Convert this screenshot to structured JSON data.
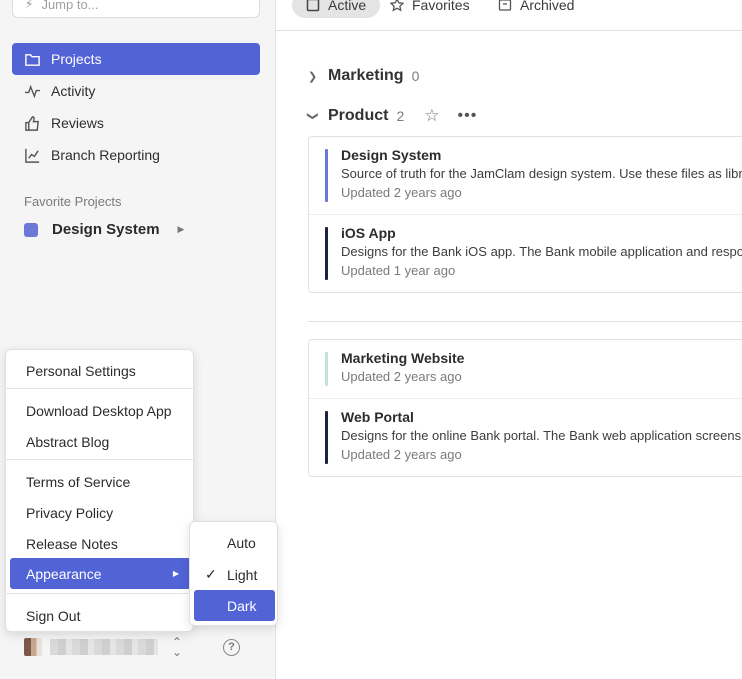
{
  "sidebar": {
    "jump_placeholder": "Jump to...",
    "nav": [
      {
        "label": "Projects",
        "icon": "folder-icon",
        "active": true
      },
      {
        "label": "Activity",
        "icon": "activity-icon"
      },
      {
        "label": "Reviews",
        "icon": "thumbs-up-icon"
      },
      {
        "label": "Branch Reporting",
        "icon": "chart-icon"
      }
    ],
    "favorites_title": "Favorite Projects",
    "favorites": [
      {
        "label": "Design System",
        "color": "#6b78d8"
      }
    ],
    "help_glyph": "?"
  },
  "tabs": [
    {
      "label": "Active",
      "active": true
    },
    {
      "label": "Favorites"
    },
    {
      "label": "Archived"
    }
  ],
  "sections": [
    {
      "title": "Marketing",
      "count": "0",
      "expanded": false
    },
    {
      "title": "Product",
      "count": "2",
      "expanded": true
    }
  ],
  "product_projects": [
    {
      "name": "Design System",
      "desc": "Source of truth for the JamClam design system. Use these files as libraries.",
      "updated": "Updated 2 years ago",
      "color": "#6b78d8"
    },
    {
      "name": "iOS App",
      "desc": "Designs for the Bank iOS app. The Bank mobile application and responsive screens.",
      "updated": "Updated 1 year ago",
      "color": "#1c2340"
    }
  ],
  "other_projects": [
    {
      "name": "Marketing Website",
      "updated": "Updated 2 years ago",
      "color": "#bfe3d6"
    },
    {
      "name": "Web Portal",
      "desc": "Designs for the online Bank portal. The Bank web application screens and flows.",
      "updated": "Updated 2 years ago",
      "color": "#1c2340"
    }
  ],
  "menu": {
    "personal_settings": "Personal Settings",
    "download_app": "Download Desktop App",
    "blog": "Abstract Blog",
    "terms": "Terms of Service",
    "privacy": "Privacy Policy",
    "release_notes": "Release Notes",
    "appearance": "Appearance",
    "sign_out": "Sign Out"
  },
  "appearance_menu": {
    "auto": "Auto",
    "light": "Light",
    "dark": "Dark",
    "selected": "Light",
    "highlighted": "Dark"
  },
  "colors": {
    "accent": "#5263d6"
  }
}
